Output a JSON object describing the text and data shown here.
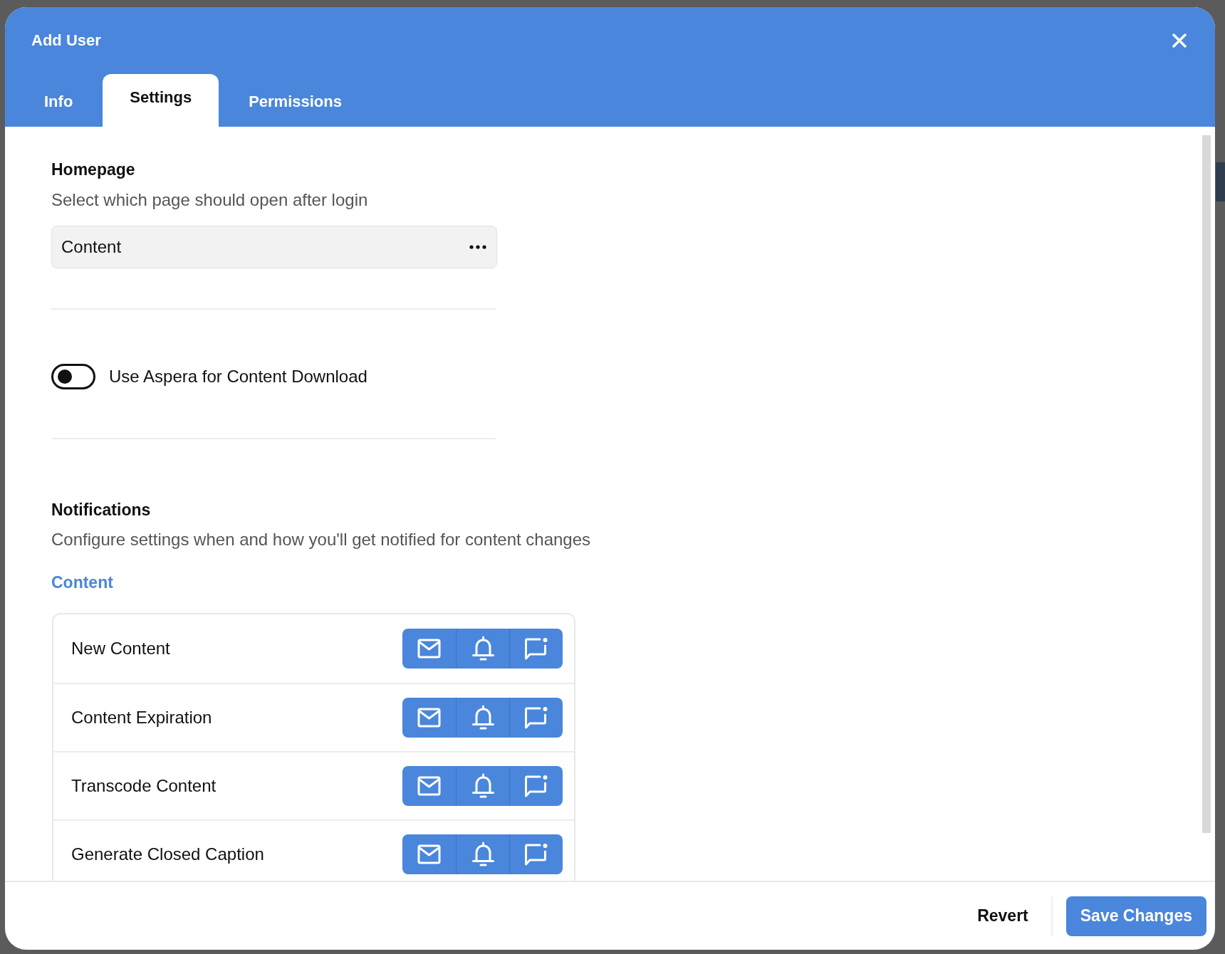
{
  "dialog": {
    "title": "Add User"
  },
  "tabs": [
    {
      "label": "Info",
      "selected": false
    },
    {
      "label": "Settings",
      "selected": true
    },
    {
      "label": "Permissions",
      "selected": false
    }
  ],
  "homepage": {
    "heading": "Homepage",
    "description": "Select which page should open after login",
    "field": {
      "value": "Content"
    }
  },
  "aspera_toggle": {
    "label": "Use Aspera for Content Download",
    "on": false
  },
  "notifications": {
    "heading": "Notifications",
    "description": "Configure settings when and how you'll get notified for content changes",
    "group_title": "Content",
    "rows": [
      {
        "label": "New Content",
        "channels": [
          {
            "kind": "email",
            "on": true
          },
          {
            "kind": "bell",
            "on": true
          },
          {
            "kind": "message",
            "on": true
          }
        ]
      },
      {
        "label": "Content Expiration",
        "channels": [
          {
            "kind": "email",
            "on": true
          },
          {
            "kind": "bell",
            "on": true
          },
          {
            "kind": "message",
            "on": true
          }
        ]
      },
      {
        "label": "Transcode Content",
        "channels": [
          {
            "kind": "email",
            "on": true
          },
          {
            "kind": "bell",
            "on": true
          },
          {
            "kind": "message",
            "on": true
          }
        ]
      },
      {
        "label": "Generate Closed Caption",
        "channels": [
          {
            "kind": "email",
            "on": true
          },
          {
            "kind": "bell",
            "on": true
          },
          {
            "kind": "message",
            "on": true
          }
        ]
      }
    ]
  },
  "footer": {
    "buttons": [
      {
        "label": "Revert",
        "kind": "secondary"
      },
      {
        "label": "Save Changes",
        "kind": "primary"
      }
    ]
  }
}
